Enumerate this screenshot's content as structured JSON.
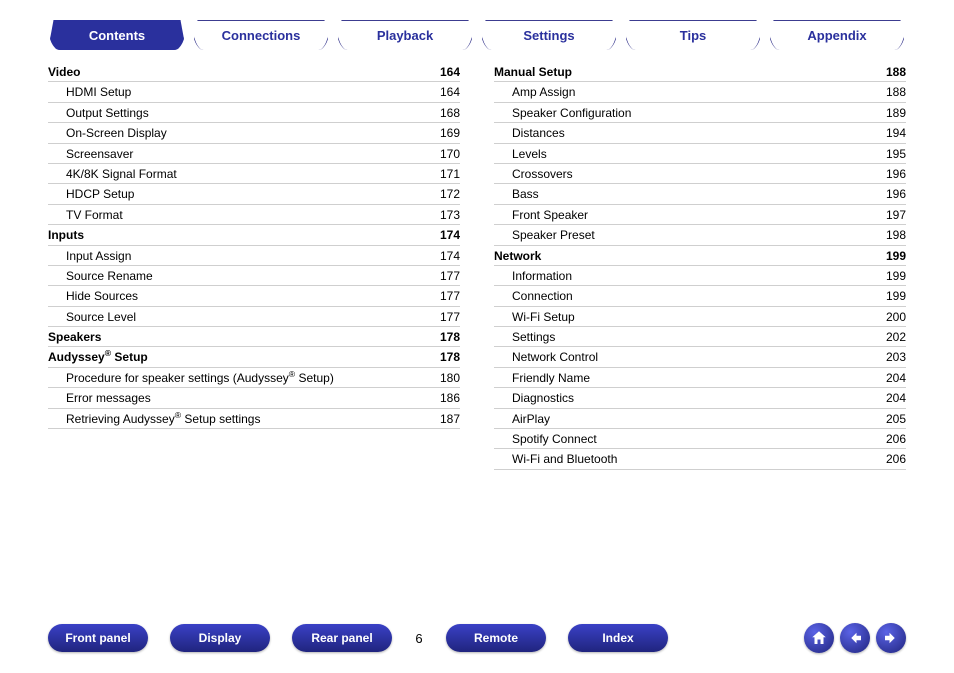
{
  "tabs": [
    {
      "id": "contents",
      "label": "Contents",
      "active": true
    },
    {
      "id": "connections",
      "label": "Connections",
      "active": false
    },
    {
      "id": "playback",
      "label": "Playback",
      "active": false
    },
    {
      "id": "settings",
      "label": "Settings",
      "active": false
    },
    {
      "id": "tips",
      "label": "Tips",
      "active": false
    },
    {
      "id": "appendix",
      "label": "Appendix",
      "active": false
    }
  ],
  "toc_left": [
    {
      "type": "section",
      "label": "Video",
      "page": 164
    },
    {
      "type": "sub",
      "label": "HDMI Setup",
      "page": 164
    },
    {
      "type": "sub",
      "label": "Output Settings",
      "page": 168
    },
    {
      "type": "sub",
      "label": "On-Screen Display",
      "page": 169
    },
    {
      "type": "sub",
      "label": "Screensaver",
      "page": 170
    },
    {
      "type": "sub",
      "label": "4K/8K Signal Format",
      "page": 171
    },
    {
      "type": "sub",
      "label": "HDCP Setup",
      "page": 172
    },
    {
      "type": "sub",
      "label": "TV Format",
      "page": 173
    },
    {
      "type": "section",
      "label": "Inputs",
      "page": 174
    },
    {
      "type": "sub",
      "label": "Input Assign",
      "page": 174
    },
    {
      "type": "sub",
      "label": "Source Rename",
      "page": 177
    },
    {
      "type": "sub",
      "label": "Hide Sources",
      "page": 177
    },
    {
      "type": "sub",
      "label": "Source Level",
      "page": 177
    },
    {
      "type": "section",
      "label": "Speakers",
      "page": 178
    },
    {
      "type": "section",
      "label_html": "Audyssey<span class='reg'>®</span> Setup",
      "label": "Audyssey® Setup",
      "page": 178
    },
    {
      "type": "sub",
      "label_html": "Procedure for speaker settings (Audyssey<span class='reg'>®</span> Setup)",
      "label": "Procedure for speaker settings (Audyssey® Setup)",
      "page": 180
    },
    {
      "type": "sub",
      "label": "Error messages",
      "page": 186
    },
    {
      "type": "sub",
      "label_html": "Retrieving Audyssey<span class='reg'>®</span> Setup settings",
      "label": "Retrieving Audyssey® Setup settings",
      "page": 187
    }
  ],
  "toc_right": [
    {
      "type": "section",
      "label": "Manual Setup",
      "page": 188
    },
    {
      "type": "sub",
      "label": "Amp Assign",
      "page": 188
    },
    {
      "type": "sub",
      "label": "Speaker Configuration",
      "page": 189
    },
    {
      "type": "sub",
      "label": "Distances",
      "page": 194
    },
    {
      "type": "sub",
      "label": "Levels",
      "page": 195
    },
    {
      "type": "sub",
      "label": "Crossovers",
      "page": 196
    },
    {
      "type": "sub",
      "label": "Bass",
      "page": 196
    },
    {
      "type": "sub",
      "label": "Front Speaker",
      "page": 197
    },
    {
      "type": "sub",
      "label": "Speaker Preset",
      "page": 198
    },
    {
      "type": "section",
      "label": "Network",
      "page": 199
    },
    {
      "type": "sub",
      "label": "Information",
      "page": 199
    },
    {
      "type": "sub",
      "label": "Connection",
      "page": 199
    },
    {
      "type": "sub",
      "label": "Wi-Fi Setup",
      "page": 200
    },
    {
      "type": "sub",
      "label": "Settings",
      "page": 202
    },
    {
      "type": "sub",
      "label": "Network Control",
      "page": 203
    },
    {
      "type": "sub",
      "label": "Friendly Name",
      "page": 204
    },
    {
      "type": "sub",
      "label": "Diagnostics",
      "page": 204
    },
    {
      "type": "sub",
      "label": "AirPlay",
      "page": 205
    },
    {
      "type": "sub",
      "label": "Spotify Connect",
      "page": 206
    },
    {
      "type": "sub",
      "label": "Wi-Fi and Bluetooth",
      "page": 206
    }
  ],
  "bottom": {
    "front_panel": "Front panel",
    "display": "Display",
    "rear_panel": "Rear panel",
    "remote": "Remote",
    "index": "Index",
    "page_number": "6"
  }
}
